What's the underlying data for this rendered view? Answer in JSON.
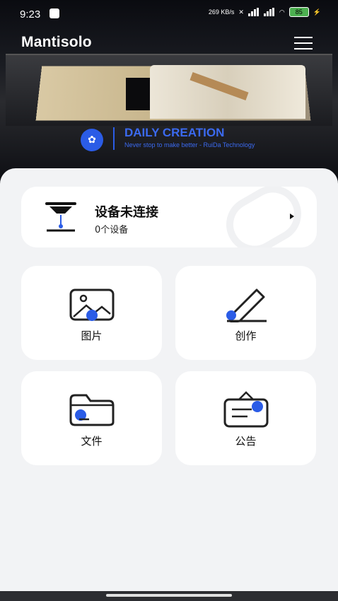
{
  "status_bar": {
    "time": "9:23",
    "network_speed": "269 KB/s",
    "battery": "85"
  },
  "header": {
    "logo": "Mantisolo",
    "brand_title": "DAILY CREATION",
    "brand_subtitle": "Never stop to make better - RuiDa Technology"
  },
  "device": {
    "title": "设备未连接",
    "subtitle": "0个设备"
  },
  "tiles": [
    {
      "label": "图片",
      "icon": "image-icon"
    },
    {
      "label": "创作",
      "icon": "pen-icon"
    },
    {
      "label": "文件",
      "icon": "folder-icon"
    },
    {
      "label": "公告",
      "icon": "announcement-icon"
    }
  ],
  "colors": {
    "accent": "#2b5ce6",
    "background": "#f2f3f5",
    "card": "#ffffff"
  }
}
